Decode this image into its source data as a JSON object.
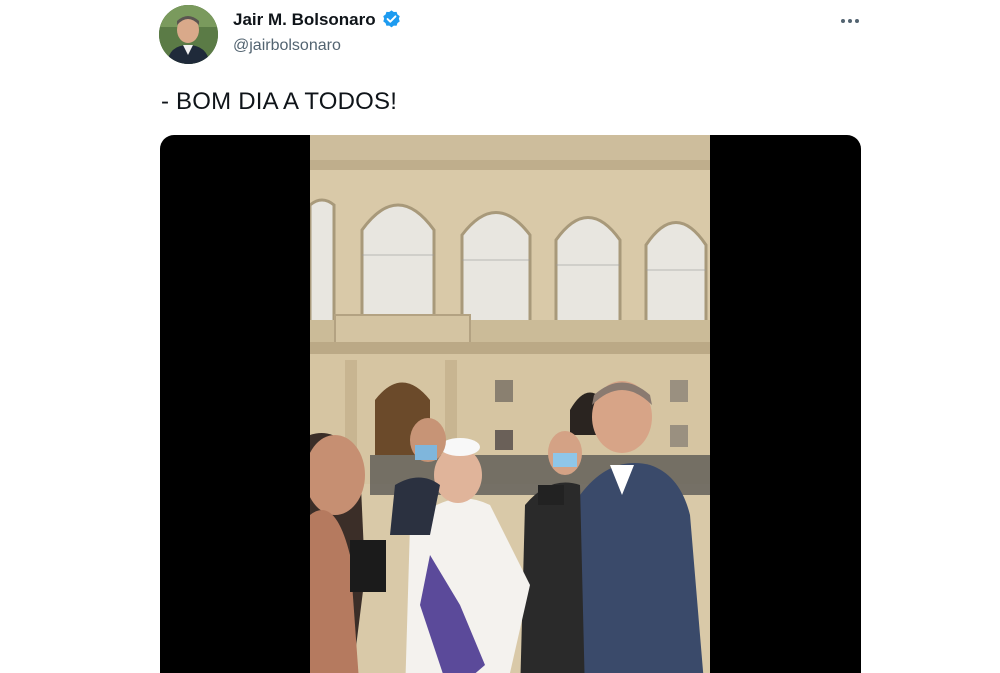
{
  "author": {
    "display_name": "Jair M. Bolsonaro",
    "handle": "@jairbolsonaro",
    "verified": true,
    "avatar_icon": "profile-photo"
  },
  "menu": {
    "icon": "more-horizontal-icon"
  },
  "tweet": {
    "text": "- BOM DIA A TODOS!"
  },
  "media": {
    "type": "video",
    "description_icon": "video-thumbnail"
  },
  "colors": {
    "verified_badge": "#1d9bf0",
    "name_text": "#0f1419",
    "handle_text": "#536471",
    "media_letterbox": "#000000"
  }
}
